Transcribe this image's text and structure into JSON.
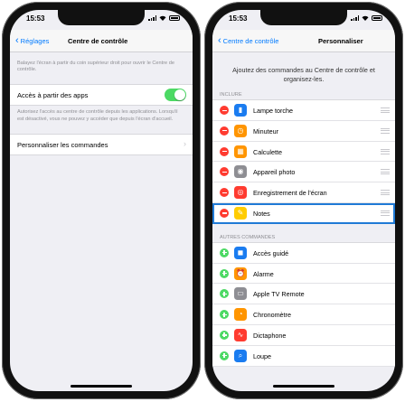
{
  "left_screen": {
    "time": "15:53",
    "back_label": "Réglages",
    "title": "Centre de contrôle",
    "intro_note": "Balayez l'écran à partir du coin supérieur droit pour ouvrir le Centre de contrôle.",
    "access_label": "Accès à partir des apps",
    "access_toggle_on": true,
    "access_note": "Autorisez l'accès au centre de contrôle depuis les applications. Lorsqu'il est désactivé, vous ne pouvez y accéder que depuis l'écran d'accueil.",
    "customize_label": "Personnaliser les commandes"
  },
  "right_screen": {
    "time": "15:53",
    "back_label": "Centre de contrôle",
    "title": "Personnaliser",
    "intro": "Ajoutez des commandes au Centre de contrôle et organisez-les.",
    "include_header": "INCLURE",
    "included": [
      {
        "label": "Lampe torche",
        "icon": "flashlight-icon",
        "glyph": "▮",
        "color": "#1a7cf0"
      },
      {
        "label": "Minuteur",
        "icon": "timer-icon",
        "glyph": "◷",
        "color": "#ff9500"
      },
      {
        "label": "Calculette",
        "icon": "calculator-icon",
        "glyph": "▦",
        "color": "#ff9500"
      },
      {
        "label": "Appareil photo",
        "icon": "camera-icon",
        "glyph": "◉",
        "color": "#8e8e93"
      },
      {
        "label": "Enregistrement de l'écran",
        "icon": "screen-recording-icon",
        "glyph": "◎",
        "color": "#ff3b30"
      },
      {
        "label": "Notes",
        "icon": "notes-icon",
        "glyph": "✎",
        "color": "#ffcc00",
        "highlight": true
      }
    ],
    "other_header": "AUTRES COMMANDES",
    "others": [
      {
        "label": "Accès guidé",
        "icon": "guided-access-icon",
        "glyph": "◼",
        "color": "#1a7cf0"
      },
      {
        "label": "Alarme",
        "icon": "alarm-icon",
        "glyph": "⏰",
        "color": "#ff9500"
      },
      {
        "label": "Apple TV Remote",
        "icon": "apple-tv-remote-icon",
        "glyph": "▭",
        "color": "#8e8e93"
      },
      {
        "label": "Chronomètre",
        "icon": "stopwatch-icon",
        "glyph": "◔",
        "color": "#ff9500"
      },
      {
        "label": "Dictaphone",
        "icon": "voice-memos-icon",
        "glyph": "∿",
        "color": "#ff3b30"
      },
      {
        "label": "Loupe",
        "icon": "magnifier-icon",
        "glyph": "⌕",
        "color": "#1a7cf0"
      }
    ]
  }
}
